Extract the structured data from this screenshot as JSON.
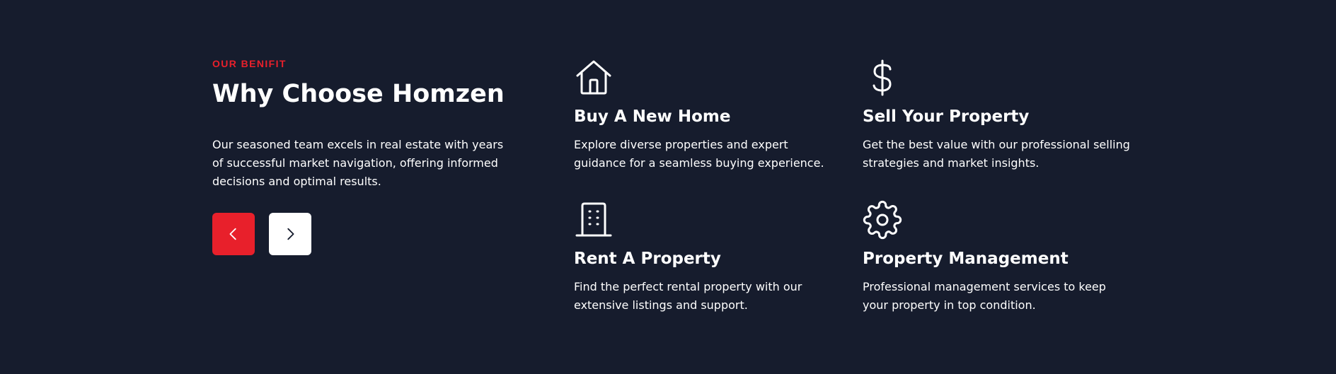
{
  "section": {
    "eyebrow": "OUR BENIFIT",
    "title": "Why Choose Homzen",
    "description": "Our seasoned team excels in real estate with years of successful market navigation, offering informed decisions and optimal results."
  },
  "carousel": {
    "prev_icon": "chevron-left-icon",
    "next_icon": "chevron-right-icon",
    "prev_color": "#e8202b",
    "next_color": "#ffffff"
  },
  "features": [
    {
      "icon": "house-icon",
      "title": "Buy A New Home",
      "description": "Explore diverse properties and expert guidance for a seamless buying experience."
    },
    {
      "icon": "dollar-icon",
      "title": "Sell Your Property",
      "description": "Get the best value with our professional selling strategies and market insights."
    },
    {
      "icon": "building-icon",
      "title": "Rent A Property",
      "description": "Find the perfect rental property with our extensive listings and support."
    },
    {
      "icon": "gear-icon",
      "title": "Property Management",
      "description": "Professional management services to keep your property in top condition."
    }
  ],
  "colors": {
    "background": "#161c2d",
    "accent": "#e8202b",
    "text": "#ffffff"
  }
}
